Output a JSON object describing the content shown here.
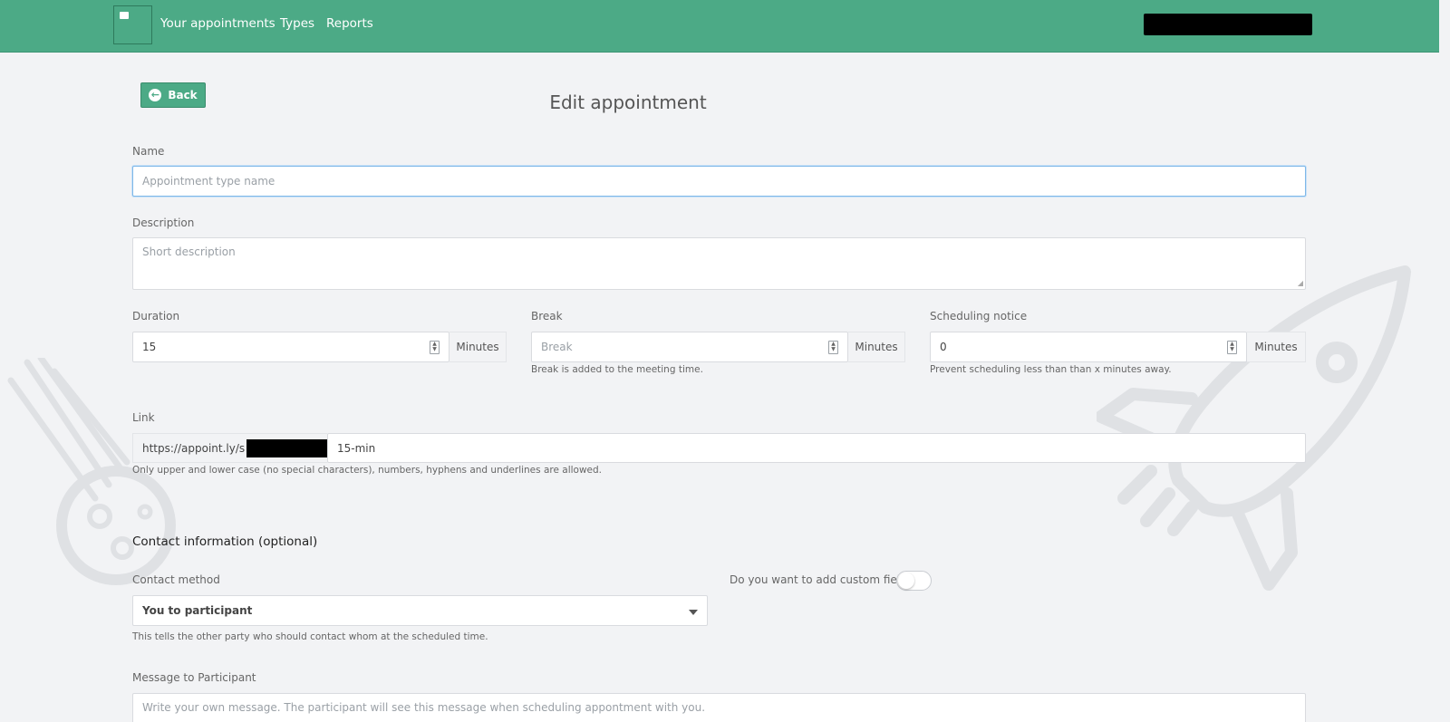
{
  "nav": {
    "items": [
      "Your appointments",
      "Types",
      "Reports"
    ]
  },
  "page": {
    "back_label": "Back",
    "title": "Edit appointment"
  },
  "form": {
    "name": {
      "label": "Name",
      "placeholder": "Appointment type name"
    },
    "description": {
      "label": "Description",
      "placeholder": "Short description"
    },
    "duration": {
      "label": "Duration",
      "value": "15",
      "unit": "Minutes"
    },
    "break": {
      "label": "Break",
      "placeholder": "Break",
      "unit": "Minutes",
      "help": "Break is added to the meeting time."
    },
    "scheduling_notice": {
      "label": "Scheduling notice",
      "value": "0",
      "unit": "Minutes",
      "help": "Prevent scheduling less than than x minutes away."
    },
    "link": {
      "label": "Link",
      "prefix": "https://appoint.ly/s",
      "value": "15-min",
      "help": "Only upper and lower case (no special characters), numbers, hyphens and underlines are allowed."
    },
    "contact_section_title": "Contact information (optional)",
    "contact_method": {
      "label": "Contact method",
      "value": "You to participant",
      "help": "This tells the other party who should contact whom at the scheduled time."
    },
    "custom_field": {
      "label": "Do you want to add custom field?",
      "enabled": false
    },
    "message": {
      "label": "Message to Participant",
      "placeholder": "Write your own message. The participant will see this message when scheduling appontment with you."
    }
  },
  "colors": {
    "brand": "#4caa86",
    "background": "#f2f3f5",
    "focus_border": "#7fb8e8"
  }
}
